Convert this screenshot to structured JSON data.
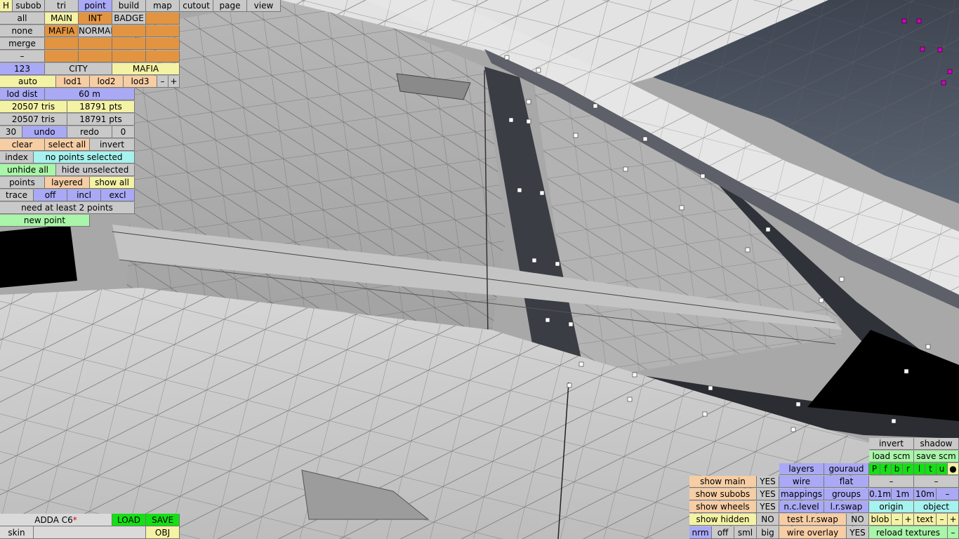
{
  "menu": {
    "items": [
      "H",
      "subob",
      "tri",
      "point",
      "build",
      "map",
      "cutout",
      "page",
      "view"
    ]
  },
  "left": {
    "all": "all",
    "main": "MAIN",
    "int": "INT",
    "badge": "BADGE",
    "none": "none",
    "mafia": "MAFIA",
    "normal": "NORMAL",
    "merge": "merge",
    "dash": "–",
    "num123": "123",
    "city": "CITY",
    "mafia2": "MAFIA",
    "auto": "auto",
    "lod1": "lod1",
    "lod2": "lod2",
    "lod3": "lod3",
    "minus": "–",
    "plus": "+",
    "lod_dist": "lod dist",
    "lod_dist_val": "60 m",
    "tris1": "20507 tris",
    "pts1": "18791 pts",
    "tris2": "20507 tris",
    "pts2": "18791 pts",
    "n30": "30",
    "undo": "undo",
    "redo": "redo",
    "n0": "0",
    "clear": "clear",
    "select_all": "select all",
    "invert": "invert",
    "index": "index",
    "no_points": "no points selected",
    "unhide_all": "unhide all",
    "hide_unselected": "hide unselected",
    "points": "points",
    "layered": "layered",
    "show_all": "show all",
    "trace": "trace",
    "off": "off",
    "incl": "incl",
    "excl": "excl",
    "need_points": "need at least 2 points",
    "new_point": "new point"
  },
  "bottom_left": {
    "title": "ADDA C6",
    "star": "*",
    "load": "LOAD",
    "save": "SAVE",
    "skin": "skin",
    "obj": "OBJ"
  },
  "right": {
    "invert": "invert",
    "shadow": "shadow",
    "load_scm": "load scm",
    "save_scm": "save scm",
    "layers": "layers",
    "gouraud": "gouraud",
    "pflags": [
      "P",
      "f",
      "b",
      "r",
      "l",
      "t",
      "u",
      "●"
    ],
    "show_main": "show main",
    "yes1": "YES",
    "wire": "wire",
    "flat": "flat",
    "dash1": "–",
    "dash2": "–",
    "show_subobs": "show subobs",
    "yes2": "YES",
    "mappings": "mappings",
    "groups": "groups",
    "d01": "0.1m",
    "d1": "1m",
    "d10": "10m",
    "dmin": "–",
    "show_wheels": "show wheels",
    "yes3": "YES",
    "nclevel": "n.c.level",
    "lrswap": "l.r.swap",
    "origin": "origin",
    "object": "object",
    "show_hidden": "show hidden",
    "no1": "NO",
    "test_lrswap": "test l.r.swap",
    "no2": "NO",
    "blob": "blob",
    "bminus": "–",
    "bplus": "+",
    "text": "text",
    "tminus": "–",
    "tplus": "+",
    "nrm": "nrm",
    "off": "off",
    "sml": "sml",
    "big": "big",
    "wire_overlay": "wire overlay",
    "yes4": "YES",
    "reload": "reload textures",
    "rminus": "–"
  },
  "colors": {
    "grey": "#c9c9c9",
    "blue": "#a9a9f6",
    "orange": "#e39440",
    "yellow": "#f4f2a4",
    "cyan": "#a6f2ee",
    "green": "#a9f5a9",
    "bright_green": "#14e014"
  }
}
